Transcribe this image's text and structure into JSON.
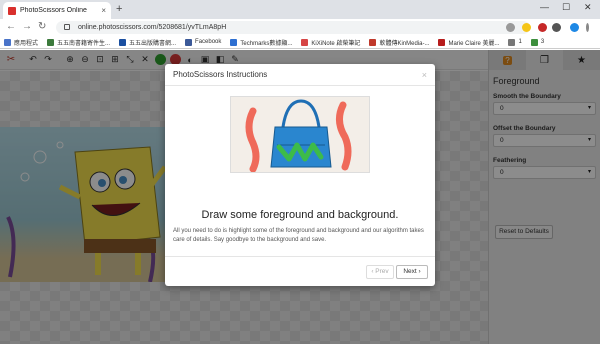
{
  "browser": {
    "tab_title": "PhotoScissors Online",
    "tab_close": "×",
    "new_tab": "+",
    "url": "online.photoscissors.com/5208681/yvTLmA8pH",
    "minimize": "—",
    "maximize": "☐",
    "close": "✕",
    "back": "←",
    "forward": "→",
    "reload": "↻"
  },
  "bookmarks": [
    {
      "label": "應用程式",
      "color": "#4a74c9"
    },
    {
      "label": "五五南書籍寄件生...",
      "color": "#3c7a3c"
    },
    {
      "label": "五五出版購書網...",
      "color": "#1a4fa0"
    },
    {
      "label": "Facebook",
      "color": "#3b5998"
    },
    {
      "label": "Techmarks數據顯...",
      "color": "#2e6fd1"
    },
    {
      "label": "KiXiNote 啟榮筆記",
      "color": "#d64545"
    },
    {
      "label": "軟體傳KinMedia-...",
      "color": "#c0392b"
    },
    {
      "label": "Marie Claire 美麗...",
      "color": "#b71c1c"
    },
    {
      "label": "1",
      "color": "#777"
    },
    {
      "label": "3",
      "color": "#3d8f3d"
    }
  ],
  "app_toolbar": {
    "undo": "↶",
    "redo": "↷",
    "zoom_in": "⊕",
    "zoom_out": "⊖",
    "zoom_fit": "⊡",
    "zoom_actual": "⊞",
    "crop": "⤡",
    "cancel": "✕",
    "marker_foreground_color": "#2e9e2e",
    "marker_background_color": "#d93a3a",
    "eraser": "◐"
  },
  "sidebar": {
    "tab_icons": [
      "?",
      "❐",
      "★"
    ],
    "title": "Foreground",
    "smooth_label": "Smooth the Boundary",
    "smooth_value": "0",
    "offset_label": "Offset the Boundary",
    "offset_value": "0",
    "feather_label": "Feathering",
    "feather_value": "0",
    "reset_label": "Reset to Defaults"
  },
  "modal": {
    "title": "PhotoScissors Instructions",
    "close": "×",
    "heading": "Draw some foreground and background.",
    "body": "All you need to do is highlight some of the foreground and background and our algorithm takes care of details. Say goodbye to the background and save.",
    "prev_label": "‹ Prev",
    "next_label": "Next ›"
  }
}
